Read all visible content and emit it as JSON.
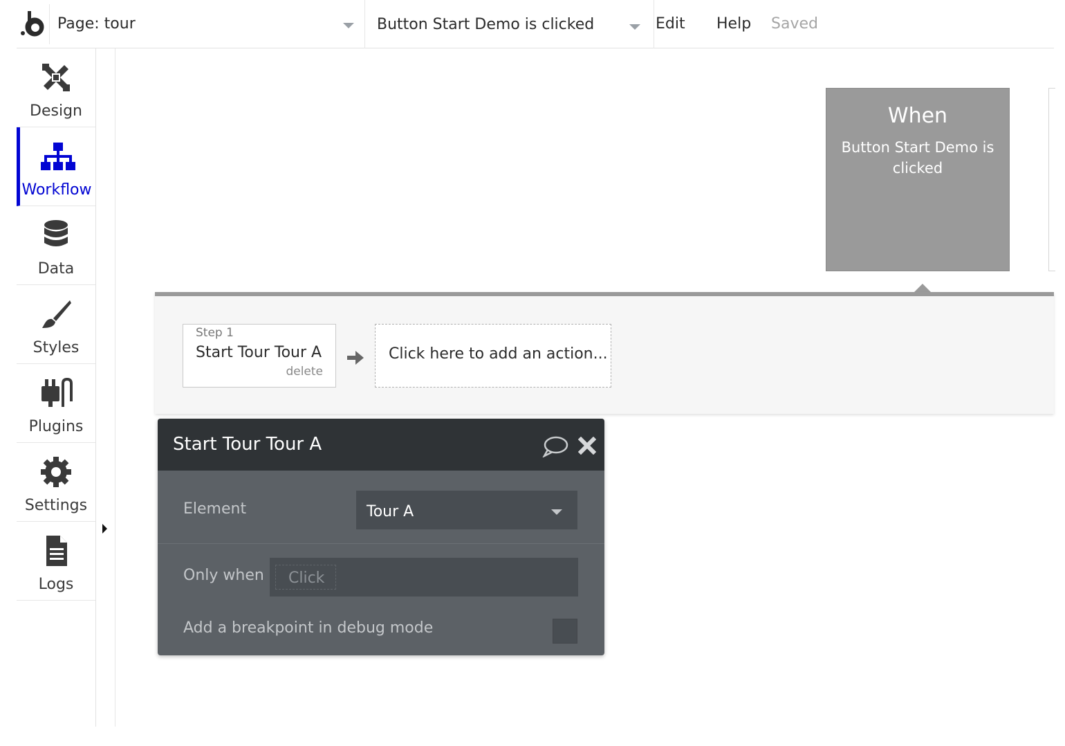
{
  "topbar": {
    "page_label": "Page: tour",
    "event_label": "Button Start Demo is clicked",
    "menu": {
      "edit": "Edit",
      "help": "Help",
      "status": "Saved"
    }
  },
  "sidebar": {
    "items": [
      {
        "label": "Design",
        "icon": "design-icon"
      },
      {
        "label": "Workflow",
        "icon": "workflow-icon",
        "active": true
      },
      {
        "label": "Data",
        "icon": "database-icon"
      },
      {
        "label": "Styles",
        "icon": "brush-icon"
      },
      {
        "label": "Plugins",
        "icon": "plugin-icon"
      },
      {
        "label": "Settings",
        "icon": "gear-icon"
      },
      {
        "label": "Logs",
        "icon": "document-icon"
      }
    ]
  },
  "event_card": {
    "heading": "When",
    "description": "Button Start Demo is clicked"
  },
  "actions": {
    "step_number": "Step 1",
    "step_name": "Start Tour Tour A",
    "step_delete": "delete",
    "add_action": "Click here to add an action..."
  },
  "panel": {
    "title": "Start Tour Tour A",
    "element_label": "Element",
    "element_value": "Tour A",
    "only_when_label": "Only when",
    "only_when_placeholder": "Click",
    "breakpoint_label": "Add a breakpoint in debug mode",
    "breakpoint_checked": false
  },
  "colors": {
    "accent": "#0205d3",
    "event_card": "#9a9a9a",
    "panel_header": "#2f3336",
    "panel_body": "#5c6166"
  }
}
